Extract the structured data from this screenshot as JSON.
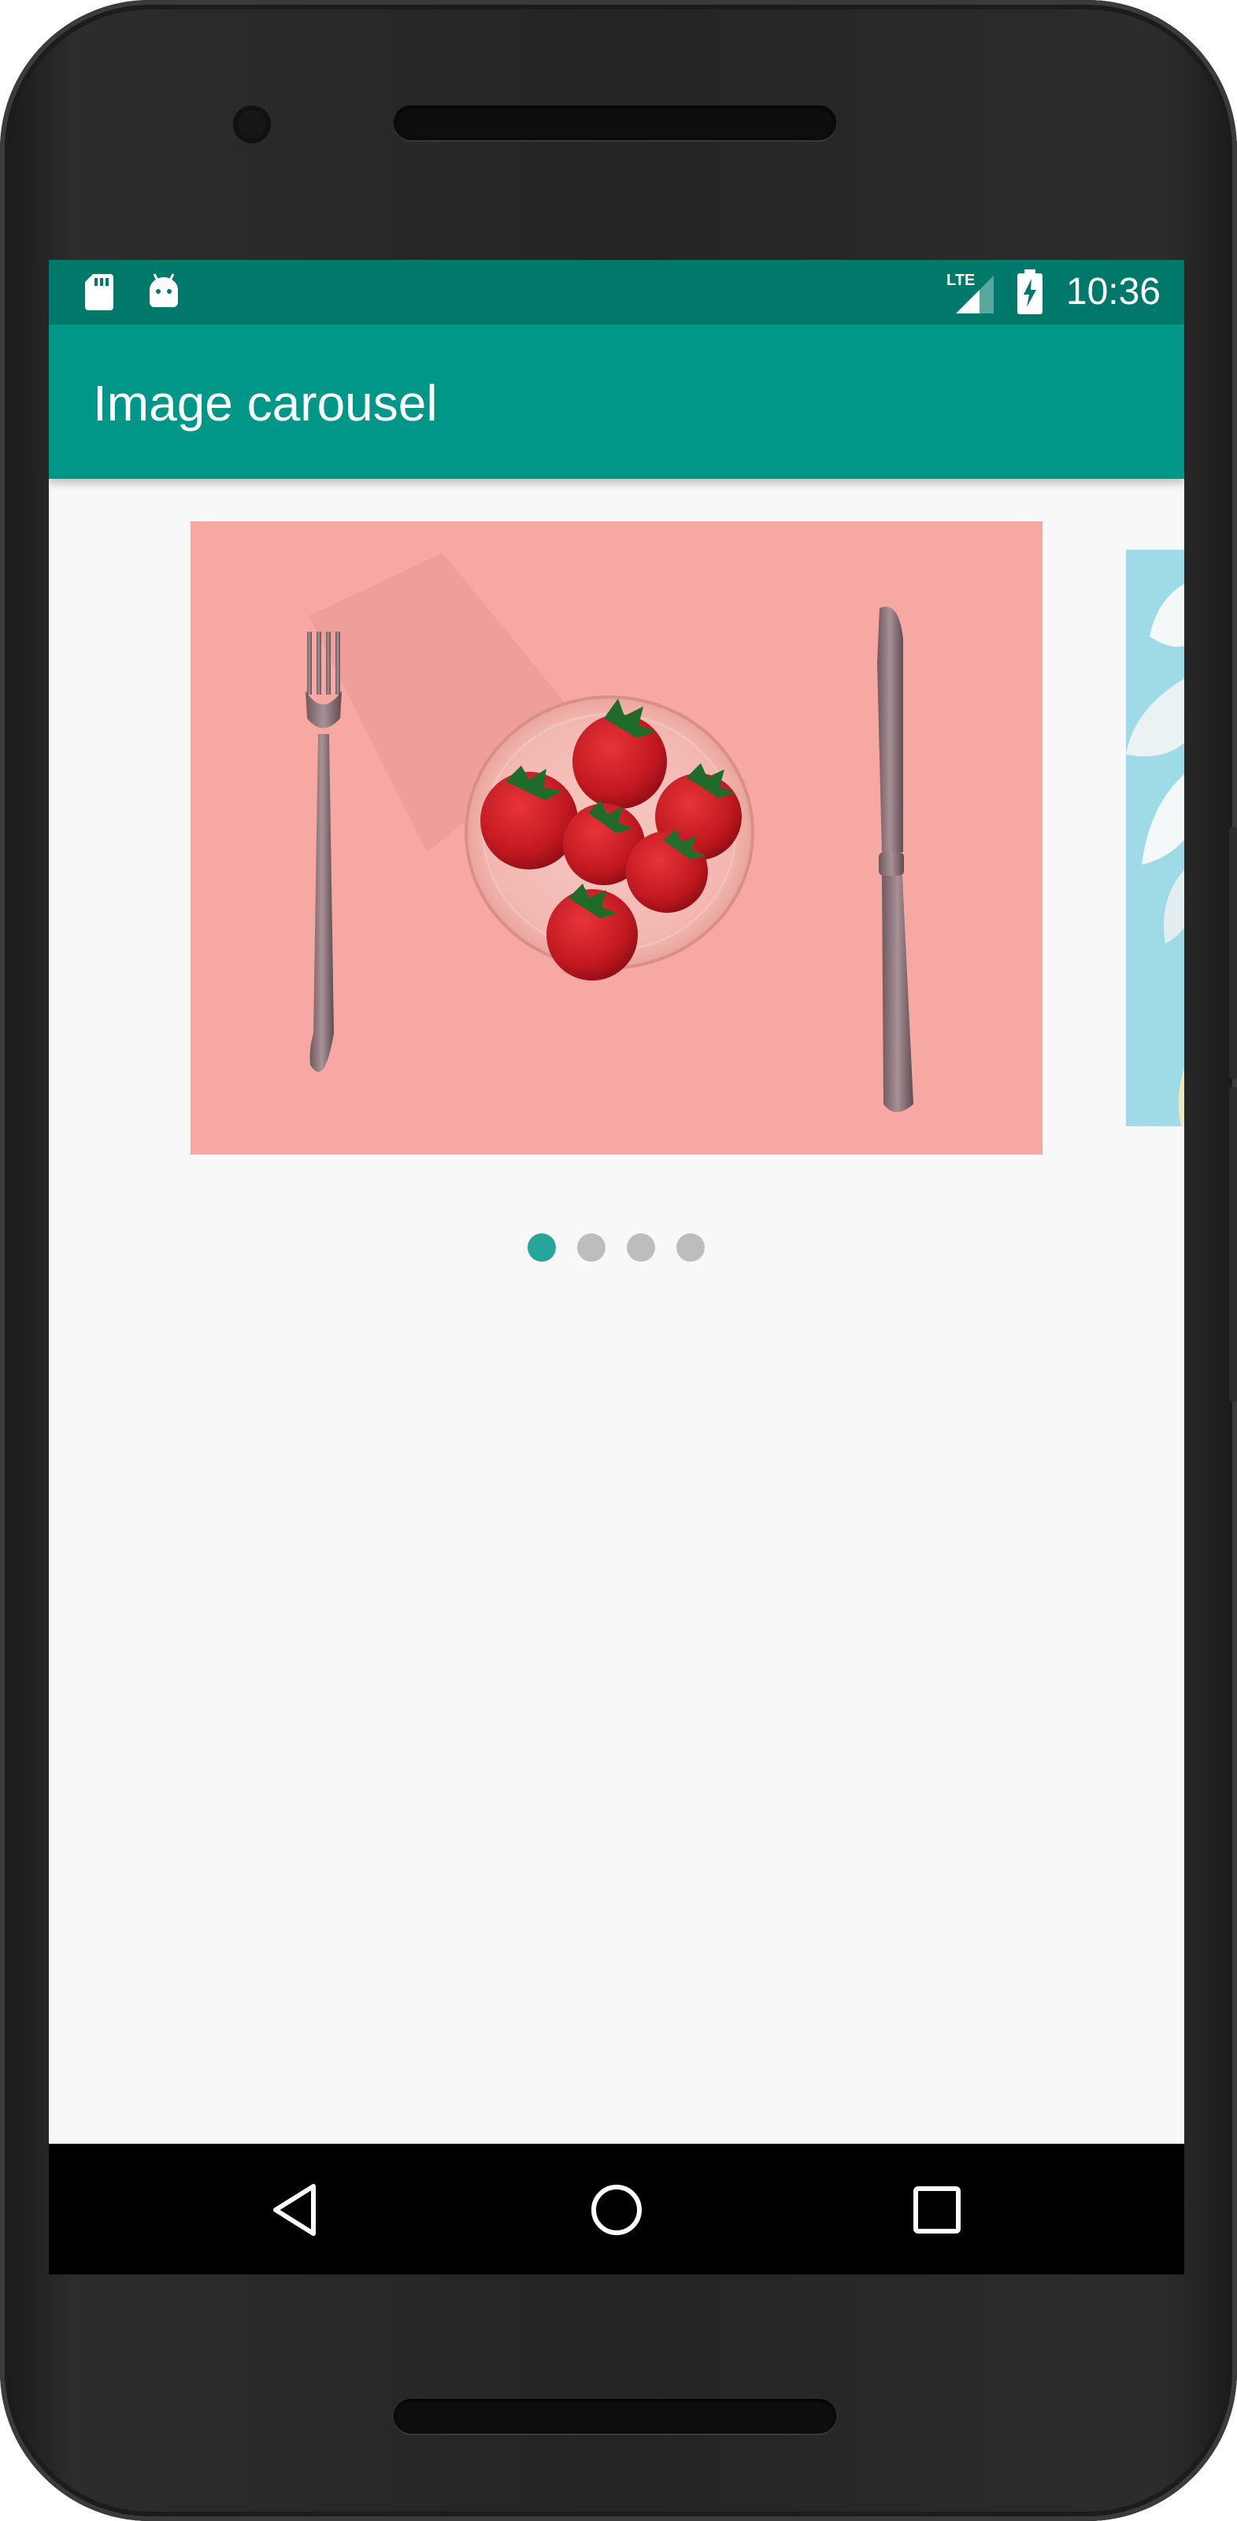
{
  "status_bar": {
    "icons_left": [
      "sd-card-icon",
      "android-debug-icon"
    ],
    "icons_right": [
      "lte-signal-icon",
      "battery-charging-icon"
    ],
    "network_label": "LTE",
    "time": "10:36"
  },
  "app_bar": {
    "title": "Image carousel"
  },
  "carousel": {
    "slide_count": 4,
    "active_index": 0,
    "slides": [
      {
        "name": "strawberries-with-fork-and-knife",
        "background": "#f8a8a2"
      },
      {
        "name": "white-flower-on-blue",
        "background": "#9fdbe6"
      }
    ]
  },
  "navigation_bar": {
    "buttons": [
      "back-icon",
      "home-icon",
      "recents-icon"
    ]
  },
  "colors": {
    "status_bar": "#00786a",
    "app_bar": "#009688",
    "indicator_active": "#26a69a",
    "indicator_inactive": "#bdbdbd",
    "screen_background": "#f8f8f8"
  }
}
